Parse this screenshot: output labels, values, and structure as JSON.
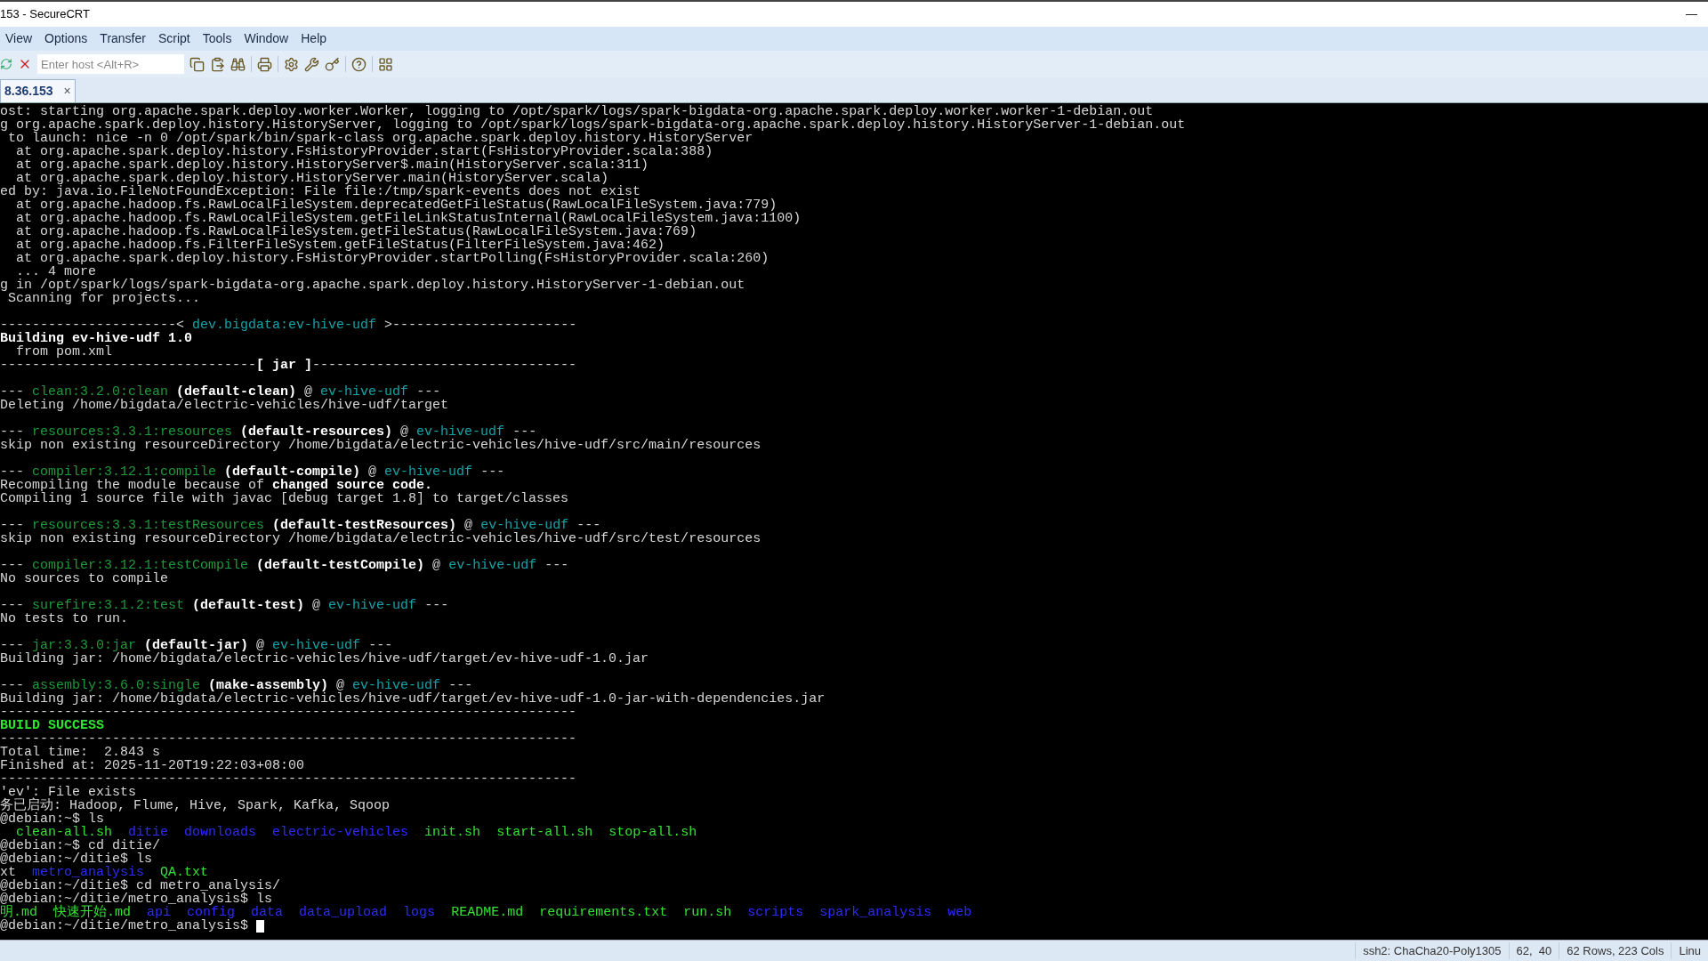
{
  "window": {
    "title": "153 - SecureCRT",
    "minimize": "—"
  },
  "menu": [
    "View",
    "Options",
    "Transfer",
    "Script",
    "Tools",
    "Window",
    "Help"
  ],
  "toolbar": {
    "host_field": {
      "placeholder": "Enter host <Alt+R>"
    }
  },
  "tabs": [
    {
      "label": "8.36.153",
      "close": "×",
      "selected": true
    }
  ],
  "terminal": {
    "lines": [
      {
        "kind": "text",
        "segments": [
          {
            "text": "ost: starting org.apache.spark.deploy.worker.Worker, logging to /opt/spark/logs/spark-bigdata-org.apache.spark.deploy.worker.worker-1-debian.out",
            "kind": "plain"
          }
        ]
      },
      {
        "kind": "text",
        "segments": [
          {
            "text": "g org.apache.spark.deploy.history.HistoryServer, logging to /opt/spark/logs/spark-bigdata-org.apache.spark.deploy.history.HistoryServer-1-debian.out",
            "kind": "plain"
          }
        ]
      },
      {
        "kind": "text",
        "segments": [
          {
            "text": " to launch: nice -n 0 /opt/spark/bin/spark-class org.apache.spark.deploy.history.HistoryServer",
            "kind": "plain"
          }
        ]
      },
      {
        "kind": "text",
        "segments": [
          {
            "text": "  at org.apache.spark.deploy.history.FsHistoryProvider.start(FsHistoryProvider.scala:388)",
            "kind": "plain"
          }
        ]
      },
      {
        "kind": "text",
        "segments": [
          {
            "text": "  at org.apache.spark.deploy.history.HistoryServer$.main(HistoryServer.scala:311)",
            "kind": "plain"
          }
        ]
      },
      {
        "kind": "text",
        "segments": [
          {
            "text": "  at org.apache.spark.deploy.history.HistoryServer.main(HistoryServer.scala)",
            "kind": "plain"
          }
        ]
      },
      {
        "kind": "text",
        "segments": [
          {
            "text": "ed by: java.io.FileNotFoundException: File file:/tmp/spark-events does not exist",
            "kind": "plain"
          }
        ]
      },
      {
        "kind": "text",
        "segments": [
          {
            "text": "  at org.apache.hadoop.fs.RawLocalFileSystem.deprecatedGetFileStatus(RawLocalFileSystem.java:779)",
            "kind": "plain"
          }
        ]
      },
      {
        "kind": "text",
        "segments": [
          {
            "text": "  at org.apache.hadoop.fs.RawLocalFileSystem.getFileLinkStatusInternal(RawLocalFileSystem.java:1100)",
            "kind": "plain"
          }
        ]
      },
      {
        "kind": "text",
        "segments": [
          {
            "text": "  at org.apache.hadoop.fs.RawLocalFileSystem.getFileStatus(RawLocalFileSystem.java:769)",
            "kind": "plain"
          }
        ]
      },
      {
        "kind": "text",
        "segments": [
          {
            "text": "  at org.apache.hadoop.fs.FilterFileSystem.getFileStatus(FilterFileSystem.java:462)",
            "kind": "plain"
          }
        ]
      },
      {
        "kind": "text",
        "segments": [
          {
            "text": "  at org.apache.spark.deploy.history.FsHistoryProvider.startPolling(FsHistoryProvider.scala:260)",
            "kind": "plain"
          }
        ]
      },
      {
        "kind": "text",
        "segments": [
          {
            "text": "  ... 4 more",
            "kind": "plain"
          }
        ]
      },
      {
        "kind": "text",
        "segments": [
          {
            "text": "g in /opt/spark/logs/spark-bigdata-org.apache.spark.deploy.history.HistoryServer-1-debian.out",
            "kind": "plain"
          }
        ]
      },
      {
        "kind": "text",
        "segments": [
          {
            "text": " Scanning for projects...",
            "kind": "plain"
          }
        ]
      },
      {
        "kind": "blank"
      },
      {
        "kind": "text",
        "segments": [
          {
            "text": "----------------------< ",
            "kind": "plain"
          },
          {
            "text": "dev.bigdata:ev-hive-udf",
            "kind": "project"
          },
          {
            "text": " >-----------------------",
            "kind": "plain"
          }
        ]
      },
      {
        "kind": "text",
        "segments": [
          {
            "text": "Building ev-hive-udf 1.0",
            "kind": "bold"
          }
        ]
      },
      {
        "kind": "text",
        "segments": [
          {
            "text": "  from pom.xml",
            "kind": "plain"
          }
        ]
      },
      {
        "kind": "text",
        "segments": [
          {
            "text": "--------------------------------",
            "kind": "plain"
          },
          {
            "text": "[ jar ]",
            "kind": "bold"
          },
          {
            "text": "---------------------------------",
            "kind": "plain"
          }
        ]
      },
      {
        "kind": "blank"
      },
      {
        "kind": "text",
        "segments": [
          {
            "text": "--- ",
            "kind": "plain"
          },
          {
            "text": "clean:3.2.0:clean",
            "kind": "plugin"
          },
          {
            "text": " (default-clean)",
            "kind": "bold"
          },
          {
            "text": " @ ",
            "kind": "plain"
          },
          {
            "text": "ev-hive-udf",
            "kind": "project"
          },
          {
            "text": " ---",
            "kind": "plain"
          }
        ]
      },
      {
        "kind": "text",
        "segments": [
          {
            "text": "Deleting /home/bigdata/electric-vehicles/hive-udf/target",
            "kind": "plain"
          }
        ]
      },
      {
        "kind": "blank"
      },
      {
        "kind": "text",
        "segments": [
          {
            "text": "--- ",
            "kind": "plain"
          },
          {
            "text": "resources:3.3.1:resources",
            "kind": "plugin"
          },
          {
            "text": " (default-resources)",
            "kind": "bold"
          },
          {
            "text": " @ ",
            "kind": "plain"
          },
          {
            "text": "ev-hive-udf",
            "kind": "project"
          },
          {
            "text": " ---",
            "kind": "plain"
          }
        ]
      },
      {
        "kind": "text",
        "segments": [
          {
            "text": "skip non existing resourceDirectory /home/bigdata/electric-vehicles/hive-udf/src/main/resources",
            "kind": "plain"
          }
        ]
      },
      {
        "kind": "blank"
      },
      {
        "kind": "text",
        "segments": [
          {
            "text": "--- ",
            "kind": "plain"
          },
          {
            "text": "compiler:3.12.1:compile",
            "kind": "plugin"
          },
          {
            "text": " (default-compile)",
            "kind": "bold"
          },
          {
            "text": " @ ",
            "kind": "plain"
          },
          {
            "text": "ev-hive-udf",
            "kind": "project"
          },
          {
            "text": " ---",
            "kind": "plain"
          }
        ]
      },
      {
        "kind": "text",
        "segments": [
          {
            "text": "Recompiling the module because of ",
            "kind": "plain"
          },
          {
            "text": "changed source code.",
            "kind": "bold"
          }
        ]
      },
      {
        "kind": "text",
        "segments": [
          {
            "text": "Compiling 1 source file with javac [debug target 1.8] to target/classes",
            "kind": "plain"
          }
        ]
      },
      {
        "kind": "blank"
      },
      {
        "kind": "text",
        "segments": [
          {
            "text": "--- ",
            "kind": "plain"
          },
          {
            "text": "resources:3.3.1:testResources",
            "kind": "plugin"
          },
          {
            "text": " (default-testResources)",
            "kind": "bold"
          },
          {
            "text": " @ ",
            "kind": "plain"
          },
          {
            "text": "ev-hive-udf",
            "kind": "project"
          },
          {
            "text": " ---",
            "kind": "plain"
          }
        ]
      },
      {
        "kind": "text",
        "segments": [
          {
            "text": "skip non existing resourceDirectory /home/bigdata/electric-vehicles/hive-udf/src/test/resources",
            "kind": "plain"
          }
        ]
      },
      {
        "kind": "blank"
      },
      {
        "kind": "text",
        "segments": [
          {
            "text": "--- ",
            "kind": "plain"
          },
          {
            "text": "compiler:3.12.1:testCompile",
            "kind": "plugin"
          },
          {
            "text": " (default-testCompile)",
            "kind": "bold"
          },
          {
            "text": " @ ",
            "kind": "plain"
          },
          {
            "text": "ev-hive-udf",
            "kind": "project"
          },
          {
            "text": " ---",
            "kind": "plain"
          }
        ]
      },
      {
        "kind": "text",
        "segments": [
          {
            "text": "No sources to compile",
            "kind": "plain"
          }
        ]
      },
      {
        "kind": "blank"
      },
      {
        "kind": "text",
        "segments": [
          {
            "text": "--- ",
            "kind": "plain"
          },
          {
            "text": "surefire:3.1.2:test",
            "kind": "plugin"
          },
          {
            "text": " (default-test)",
            "kind": "bold"
          },
          {
            "text": " @ ",
            "kind": "plain"
          },
          {
            "text": "ev-hive-udf",
            "kind": "project"
          },
          {
            "text": " ---",
            "kind": "plain"
          }
        ]
      },
      {
        "kind": "text",
        "segments": [
          {
            "text": "No tests to run.",
            "kind": "plain"
          }
        ]
      },
      {
        "kind": "blank"
      },
      {
        "kind": "text",
        "segments": [
          {
            "text": "--- ",
            "kind": "plain"
          },
          {
            "text": "jar:3.3.0:jar",
            "kind": "plugin"
          },
          {
            "text": " (default-jar)",
            "kind": "bold"
          },
          {
            "text": " @ ",
            "kind": "plain"
          },
          {
            "text": "ev-hive-udf",
            "kind": "project"
          },
          {
            "text": " ---",
            "kind": "plain"
          }
        ]
      },
      {
        "kind": "text",
        "segments": [
          {
            "text": "Building jar: /home/bigdata/electric-vehicles/hive-udf/target/ev-hive-udf-1.0.jar",
            "kind": "plain"
          }
        ]
      },
      {
        "kind": "blank"
      },
      {
        "kind": "text",
        "segments": [
          {
            "text": "--- ",
            "kind": "plain"
          },
          {
            "text": "assembly:3.6.0:single",
            "kind": "plugin"
          },
          {
            "text": " (make-assembly)",
            "kind": "bold"
          },
          {
            "text": " @ ",
            "kind": "plain"
          },
          {
            "text": "ev-hive-udf",
            "kind": "project"
          },
          {
            "text": " ---",
            "kind": "plain"
          }
        ]
      },
      {
        "kind": "text",
        "segments": [
          {
            "text": "Building jar: /home/bigdata/electric-vehicles/hive-udf/target/ev-hive-udf-1.0-jar-with-dependencies.jar",
            "kind": "plain"
          }
        ]
      },
      {
        "kind": "text",
        "segments": [
          {
            "text": "------------------------------------------------------------------------",
            "kind": "plain"
          }
        ]
      },
      {
        "kind": "text",
        "segments": [
          {
            "text": "BUILD SUCCESS",
            "kind": "success"
          }
        ]
      },
      {
        "kind": "text",
        "segments": [
          {
            "text": "------------------------------------------------------------------------",
            "kind": "plain"
          }
        ]
      },
      {
        "kind": "text",
        "segments": [
          {
            "text": "Total time:  2.843 s",
            "kind": "plain"
          }
        ]
      },
      {
        "kind": "text",
        "segments": [
          {
            "text": "Finished at: 2025-11-20T19:22:03+08:00",
            "kind": "plain"
          }
        ]
      },
      {
        "kind": "text",
        "segments": [
          {
            "text": "------------------------------------------------------------------------",
            "kind": "plain"
          }
        ]
      },
      {
        "kind": "text",
        "segments": [
          {
            "text": "'ev': File exists",
            "kind": "plain"
          }
        ]
      },
      {
        "kind": "text",
        "segments": [
          {
            "text": "务已启动: Hadoop, Flume, Hive, Spark, Kafka, Sqoop",
            "kind": "plain"
          }
        ]
      },
      {
        "kind": "text",
        "segments": [
          {
            "text": "@debian:~$ ls",
            "kind": "plain"
          }
        ]
      },
      {
        "kind": "text",
        "segments": [
          {
            "text": "  clean-all.sh",
            "kind": "exec"
          },
          {
            "text": "  ditie",
            "kind": "dir"
          },
          {
            "text": "  downloads",
            "kind": "dir"
          },
          {
            "text": "  electric-vehicles",
            "kind": "dir"
          },
          {
            "text": "  init.sh",
            "kind": "exec"
          },
          {
            "text": "  start-all.sh",
            "kind": "exec"
          },
          {
            "text": "  stop-all.sh",
            "kind": "exec"
          }
        ]
      },
      {
        "kind": "text",
        "segments": [
          {
            "text": "@debian:~$ cd ditie/",
            "kind": "plain"
          }
        ]
      },
      {
        "kind": "text",
        "segments": [
          {
            "text": "@debian:~/ditie$ ls",
            "kind": "plain"
          }
        ]
      },
      {
        "kind": "text",
        "segments": [
          {
            "text": "xt",
            "kind": "plain"
          },
          {
            "text": "  metro_analysis",
            "kind": "dir"
          },
          {
            "text": "  QA.txt",
            "kind": "exec"
          }
        ]
      },
      {
        "kind": "text",
        "segments": [
          {
            "text": "@debian:~/ditie$ cd metro_analysis/",
            "kind": "plain"
          }
        ]
      },
      {
        "kind": "text",
        "segments": [
          {
            "text": "@debian:~/ditie/metro_analysis$ ls",
            "kind": "plain"
          }
        ]
      },
      {
        "kind": "text",
        "segments": [
          {
            "text": "明.md",
            "kind": "exec"
          },
          {
            "text": "  快速开始.md",
            "kind": "exec"
          },
          {
            "text": "  api",
            "kind": "dir"
          },
          {
            "text": "  config",
            "kind": "dir"
          },
          {
            "text": "  data",
            "kind": "dir"
          },
          {
            "text": "  data_upload",
            "kind": "dir"
          },
          {
            "text": "  logs",
            "kind": "dir"
          },
          {
            "text": "  README.md",
            "kind": "exec"
          },
          {
            "text": "  requirements.txt",
            "kind": "exec"
          },
          {
            "text": "  run.sh",
            "kind": "exec"
          },
          {
            "text": "  scripts",
            "kind": "dir"
          },
          {
            "text": "  spark_analysis",
            "kind": "dir"
          },
          {
            "text": "  web",
            "kind": "dir"
          }
        ]
      },
      {
        "kind": "text",
        "cursor": true,
        "segments": [
          {
            "text": "@debian:~/ditie/metro_analysis$",
            "kind": "plain"
          }
        ]
      }
    ]
  },
  "status_bar": [
    "ssh2: ChaCha20-Poly1305",
    "62,  40",
    "62 Rows, 223 Cols",
    "Linu"
  ]
}
